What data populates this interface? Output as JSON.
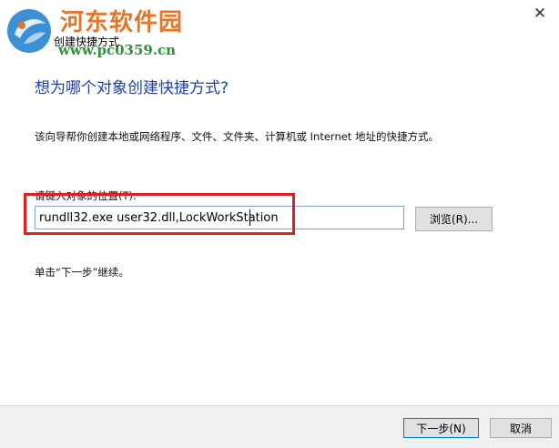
{
  "watermark": {
    "site_name": "河东软件园",
    "url": "www.pc0359.cn"
  },
  "window": {
    "title": "创建快捷方式",
    "close_glyph": "✕"
  },
  "main": {
    "heading": "想为哪个对象创建快捷方式?",
    "description": "该向导帮你创建本地或网络程序、文件、文件夹、计算机或 Internet 地址的快捷方式。",
    "location_label": "请键入对象的位置(T):",
    "location_value": "rundll32.exe user32.dll,LockWorkStation",
    "browse_label": "浏览(R)...",
    "hint": "单击“下一步”继续。"
  },
  "footer": {
    "next_label": "下一步(N)",
    "cancel_label": "取消"
  },
  "colors": {
    "heading": "#1f3ea8",
    "highlight": "#d9231e",
    "watermark_title": "#e4762a",
    "watermark_url": "#2f8f3a"
  },
  "icons": {
    "watermark_logo": "pc0359-logo",
    "close": "close-icon"
  }
}
